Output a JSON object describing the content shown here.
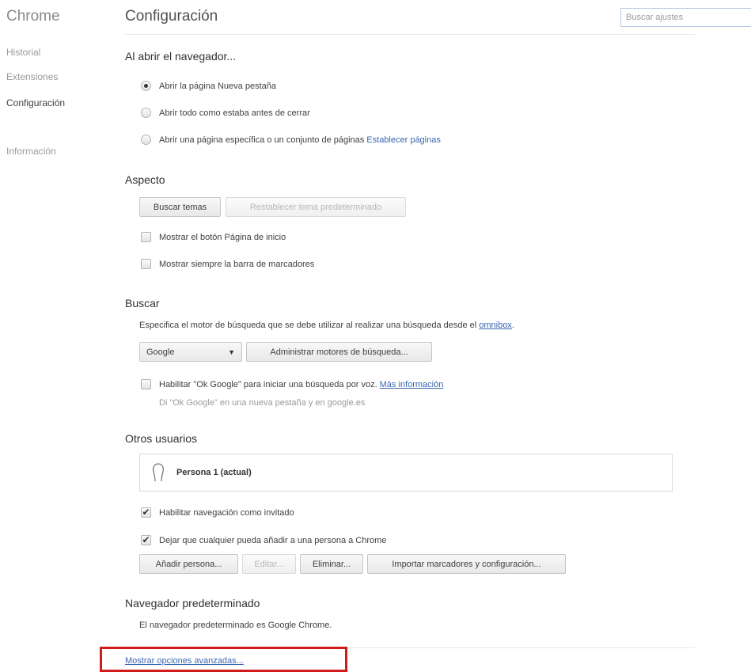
{
  "app_title": "Chrome",
  "sidebar": {
    "items": [
      {
        "label": "Historial",
        "active": false
      },
      {
        "label": "Extensiones",
        "active": false
      },
      {
        "label": "Configuración",
        "active": true
      },
      {
        "label": "Información",
        "active": false
      }
    ]
  },
  "header": {
    "title": "Configuración",
    "search_placeholder": "Buscar ajustes"
  },
  "startup": {
    "title": "Al abrir el navegador...",
    "options": [
      {
        "label": "Abrir la página Nueva pestaña",
        "checked": true
      },
      {
        "label": "Abrir todo como estaba antes de cerrar",
        "checked": false
      },
      {
        "label": "Abrir una página específica o un conjunto de páginas",
        "checked": false,
        "link": "Establecer páginas"
      }
    ]
  },
  "appearance": {
    "title": "Aspecto",
    "themes_button": "Buscar temas",
    "reset_theme_button": "Restablecer tema predeterminado",
    "show_home_button": "Mostrar el botón Página de inicio",
    "show_bookmarks_bar": "Mostrar siempre la barra de marcadores"
  },
  "search": {
    "title": "Buscar",
    "description": "Especifica el motor de búsqueda que se debe utilizar al realizar una búsqueda desde el",
    "omnibox_link": "omnibox",
    "description_end": ".",
    "engine_selected": "Google",
    "manage_button": "Administrar motores de búsqueda...",
    "ok_google_label": "Habilitar \"Ok Google\" para iniciar una búsqueda por voz.",
    "more_info_link": "Más información",
    "ok_google_hint": "Di \"Ok Google\" en una nueva pestaña y en google.es"
  },
  "users": {
    "title": "Otros usuarios",
    "profile_name": "Persona 1 (actual)",
    "guest_label": "Habilitar navegación como invitado",
    "guest_checked": true,
    "add_anyone_label": "Dejar que cualquier pueda añadir a una persona a Chrome",
    "add_anyone_checked": true,
    "add_button": "Añadir persona...",
    "edit_button": "Editar...",
    "delete_button": "Eliminar...",
    "import_button": "Importar marcadores y configuración..."
  },
  "default_browser": {
    "title": "Navegador predeterminado",
    "status": "El navegador predeterminado es Google Chrome."
  },
  "advanced_link": "Mostrar opciones avanzadas...",
  "colors": {
    "link": "#3a66b0",
    "highlight": "#d21a1a"
  }
}
